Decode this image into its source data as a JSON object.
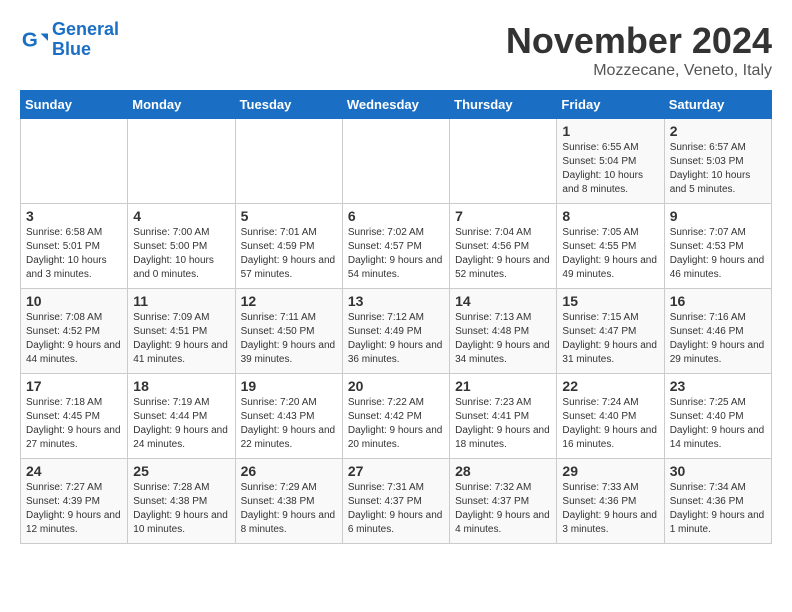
{
  "logo": {
    "line1": "General",
    "line2": "Blue"
  },
  "title": "November 2024",
  "subtitle": "Mozzecane, Veneto, Italy",
  "days_of_week": [
    "Sunday",
    "Monday",
    "Tuesday",
    "Wednesday",
    "Thursday",
    "Friday",
    "Saturday"
  ],
  "weeks": [
    [
      {
        "day": "",
        "info": ""
      },
      {
        "day": "",
        "info": ""
      },
      {
        "day": "",
        "info": ""
      },
      {
        "day": "",
        "info": ""
      },
      {
        "day": "",
        "info": ""
      },
      {
        "day": "1",
        "info": "Sunrise: 6:55 AM\nSunset: 5:04 PM\nDaylight: 10 hours and 8 minutes."
      },
      {
        "day": "2",
        "info": "Sunrise: 6:57 AM\nSunset: 5:03 PM\nDaylight: 10 hours and 5 minutes."
      }
    ],
    [
      {
        "day": "3",
        "info": "Sunrise: 6:58 AM\nSunset: 5:01 PM\nDaylight: 10 hours and 3 minutes."
      },
      {
        "day": "4",
        "info": "Sunrise: 7:00 AM\nSunset: 5:00 PM\nDaylight: 10 hours and 0 minutes."
      },
      {
        "day": "5",
        "info": "Sunrise: 7:01 AM\nSunset: 4:59 PM\nDaylight: 9 hours and 57 minutes."
      },
      {
        "day": "6",
        "info": "Sunrise: 7:02 AM\nSunset: 4:57 PM\nDaylight: 9 hours and 54 minutes."
      },
      {
        "day": "7",
        "info": "Sunrise: 7:04 AM\nSunset: 4:56 PM\nDaylight: 9 hours and 52 minutes."
      },
      {
        "day": "8",
        "info": "Sunrise: 7:05 AM\nSunset: 4:55 PM\nDaylight: 9 hours and 49 minutes."
      },
      {
        "day": "9",
        "info": "Sunrise: 7:07 AM\nSunset: 4:53 PM\nDaylight: 9 hours and 46 minutes."
      }
    ],
    [
      {
        "day": "10",
        "info": "Sunrise: 7:08 AM\nSunset: 4:52 PM\nDaylight: 9 hours and 44 minutes."
      },
      {
        "day": "11",
        "info": "Sunrise: 7:09 AM\nSunset: 4:51 PM\nDaylight: 9 hours and 41 minutes."
      },
      {
        "day": "12",
        "info": "Sunrise: 7:11 AM\nSunset: 4:50 PM\nDaylight: 9 hours and 39 minutes."
      },
      {
        "day": "13",
        "info": "Sunrise: 7:12 AM\nSunset: 4:49 PM\nDaylight: 9 hours and 36 minutes."
      },
      {
        "day": "14",
        "info": "Sunrise: 7:13 AM\nSunset: 4:48 PM\nDaylight: 9 hours and 34 minutes."
      },
      {
        "day": "15",
        "info": "Sunrise: 7:15 AM\nSunset: 4:47 PM\nDaylight: 9 hours and 31 minutes."
      },
      {
        "day": "16",
        "info": "Sunrise: 7:16 AM\nSunset: 4:46 PM\nDaylight: 9 hours and 29 minutes."
      }
    ],
    [
      {
        "day": "17",
        "info": "Sunrise: 7:18 AM\nSunset: 4:45 PM\nDaylight: 9 hours and 27 minutes."
      },
      {
        "day": "18",
        "info": "Sunrise: 7:19 AM\nSunset: 4:44 PM\nDaylight: 9 hours and 24 minutes."
      },
      {
        "day": "19",
        "info": "Sunrise: 7:20 AM\nSunset: 4:43 PM\nDaylight: 9 hours and 22 minutes."
      },
      {
        "day": "20",
        "info": "Sunrise: 7:22 AM\nSunset: 4:42 PM\nDaylight: 9 hours and 20 minutes."
      },
      {
        "day": "21",
        "info": "Sunrise: 7:23 AM\nSunset: 4:41 PM\nDaylight: 9 hours and 18 minutes."
      },
      {
        "day": "22",
        "info": "Sunrise: 7:24 AM\nSunset: 4:40 PM\nDaylight: 9 hours and 16 minutes."
      },
      {
        "day": "23",
        "info": "Sunrise: 7:25 AM\nSunset: 4:40 PM\nDaylight: 9 hours and 14 minutes."
      }
    ],
    [
      {
        "day": "24",
        "info": "Sunrise: 7:27 AM\nSunset: 4:39 PM\nDaylight: 9 hours and 12 minutes."
      },
      {
        "day": "25",
        "info": "Sunrise: 7:28 AM\nSunset: 4:38 PM\nDaylight: 9 hours and 10 minutes."
      },
      {
        "day": "26",
        "info": "Sunrise: 7:29 AM\nSunset: 4:38 PM\nDaylight: 9 hours and 8 minutes."
      },
      {
        "day": "27",
        "info": "Sunrise: 7:31 AM\nSunset: 4:37 PM\nDaylight: 9 hours and 6 minutes."
      },
      {
        "day": "28",
        "info": "Sunrise: 7:32 AM\nSunset: 4:37 PM\nDaylight: 9 hours and 4 minutes."
      },
      {
        "day": "29",
        "info": "Sunrise: 7:33 AM\nSunset: 4:36 PM\nDaylight: 9 hours and 3 minutes."
      },
      {
        "day": "30",
        "info": "Sunrise: 7:34 AM\nSunset: 4:36 PM\nDaylight: 9 hours and 1 minute."
      }
    ]
  ]
}
